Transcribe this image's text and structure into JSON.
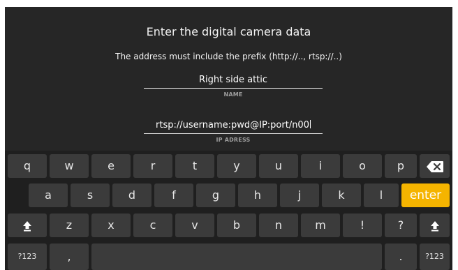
{
  "dialog": {
    "title": "Enter the digital camera data",
    "subtitle": "The address must include the prefix (http://.., rtsp://..)",
    "name_field": {
      "value": "Right side attic",
      "label": "NAME"
    },
    "ip_field": {
      "value": "rtsp://username:pwd@IP:port/n00",
      "label": "IP ADRESS"
    }
  },
  "keyboard": {
    "row1": [
      "q",
      "w",
      "e",
      "r",
      "t",
      "y",
      "u",
      "i",
      "o",
      "p"
    ],
    "row2": [
      "a",
      "s",
      "d",
      "f",
      "g",
      "h",
      "j",
      "k",
      "l"
    ],
    "enter_label": "enter",
    "row3": [
      "z",
      "x",
      "c",
      "v",
      "b",
      "n",
      "m",
      "!",
      "?"
    ],
    "symbols_label": "?123",
    "comma_label": ",",
    "period_label": ".",
    "icons": {
      "backspace": "backspace-icon",
      "shift": "shift-icon"
    },
    "colors": {
      "enter_key": "#f5b400",
      "key": "#3b3b3b",
      "background": "#1f1f1f"
    }
  }
}
